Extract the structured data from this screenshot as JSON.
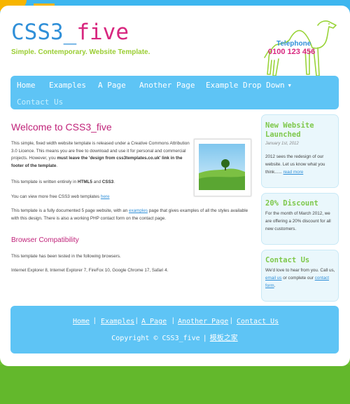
{
  "header": {
    "title_main": "CSS3_",
    "title_accent": "five",
    "slogan": "Simple. Contemporary. Website Template.",
    "telephone_label": "Telephone",
    "telephone_number": "0100 123 456"
  },
  "menu": {
    "items": [
      {
        "label": "Home"
      },
      {
        "label": "Examples"
      },
      {
        "label": "A Page"
      },
      {
        "label": "Another Page"
      },
      {
        "label": "Example Drop Down"
      },
      {
        "label": "Contact Us"
      }
    ]
  },
  "main": {
    "heading": "Welcome to CSS3_five",
    "p1_text1": "This simple, fixed width website template is released under a Creative Commons Attribution 3.0 Licence. This means you are free to download and use it for personal and commercial projects. However, you ",
    "p1_bold": "must leave the 'design from css3templates.co.uk' link in the footer of the template",
    "p1_end": ".",
    "p2_text1": "This template is written entirely in ",
    "p2_bold1": "HTML5",
    "p2_and": " and ",
    "p2_bold2": "CSS3",
    "p2_end": ".",
    "p3_text": "You can view more free CSS3 web templates ",
    "p3_link": "here",
    "p4_text1": "This template is a fully documented 5 page website, with an ",
    "p4_link": "examples",
    "p4_text2": " page that gives examples of all the styles available with this design. There is also a working PHP contact form on the contact page.",
    "subheading": "Browser Compatibility",
    "p5_text": "This template has been tested in the following browsers.",
    "p6_text": "Internet Explorer 8, Internet Explorer 7, FireFox 10, Google Chrome 17, Safari 4."
  },
  "sidebar": {
    "news": {
      "title": "New Website Launched",
      "date": "January 1st, 2012",
      "text": "2012 sees the redesign of our website. Let us know what you think......",
      "link": "read more"
    },
    "discount": {
      "title": "20% Discount",
      "text": "For the month of March 2012, we are offering a 20% discount for all new customers."
    },
    "contact": {
      "title": "Contact Us",
      "text1": "We'd love to hear from you. Call us, ",
      "link1": "email us",
      "text2": " or complete our ",
      "link2": "contact form",
      "text3": "."
    }
  },
  "footer": {
    "links": [
      {
        "label": "Home"
      },
      {
        "label": "Examples"
      },
      {
        "label": "A Page"
      },
      {
        "label": "Another Page"
      },
      {
        "label": "Contact Us"
      }
    ],
    "copyright": "Copyright © CSS3_five",
    "credit": "模板之家"
  },
  "colors": {
    "sky": "#3db6ef",
    "nav": "#5ec4f5",
    "title_blue": "#2f8fd8",
    "accent_pink": "#d8277f",
    "green": "#9acd32"
  }
}
